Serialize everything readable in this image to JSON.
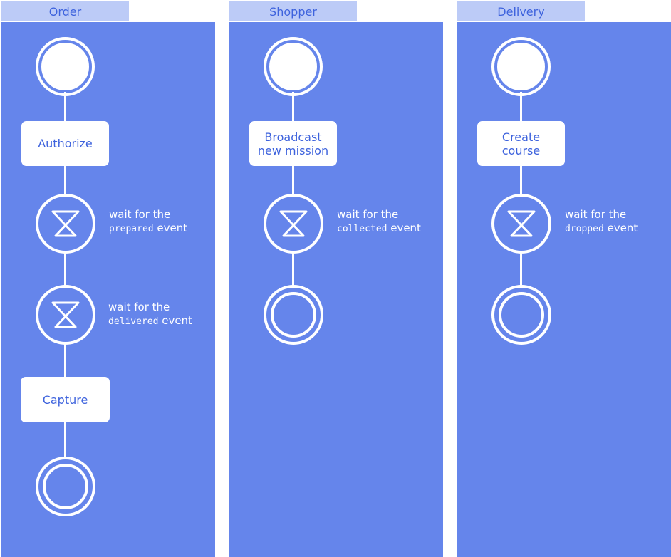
{
  "lanes": [
    {
      "title": "Order",
      "tasks": [
        "Authorize",
        "Capture"
      ],
      "waits": [
        {
          "prefix": "wait for the",
          "event_code": "prepared",
          "suffix": " event"
        },
        {
          "prefix": "wait for the",
          "event_code": "delivered",
          "suffix": " event"
        }
      ]
    },
    {
      "title": "Shopper",
      "tasks": [
        "Broadcast\nnew mission"
      ],
      "waits": [
        {
          "prefix": "wait for the",
          "event_code": "collected",
          "suffix": " event"
        }
      ]
    },
    {
      "title": "Delivery",
      "tasks": [
        "Create\ncourse"
      ],
      "waits": [
        {
          "prefix": "wait for the",
          "event_code": "dropped",
          "suffix": " event"
        }
      ]
    }
  ],
  "colors": {
    "lane_background": "#6585eb",
    "lane_tab_background": "#bccbf7",
    "accent_text": "#3e63dd",
    "foreground": "#ffffff"
  },
  "icons": {
    "start_event": "filled-circle",
    "timer_event": "hourglass-icon",
    "end_event": "double-circle"
  }
}
